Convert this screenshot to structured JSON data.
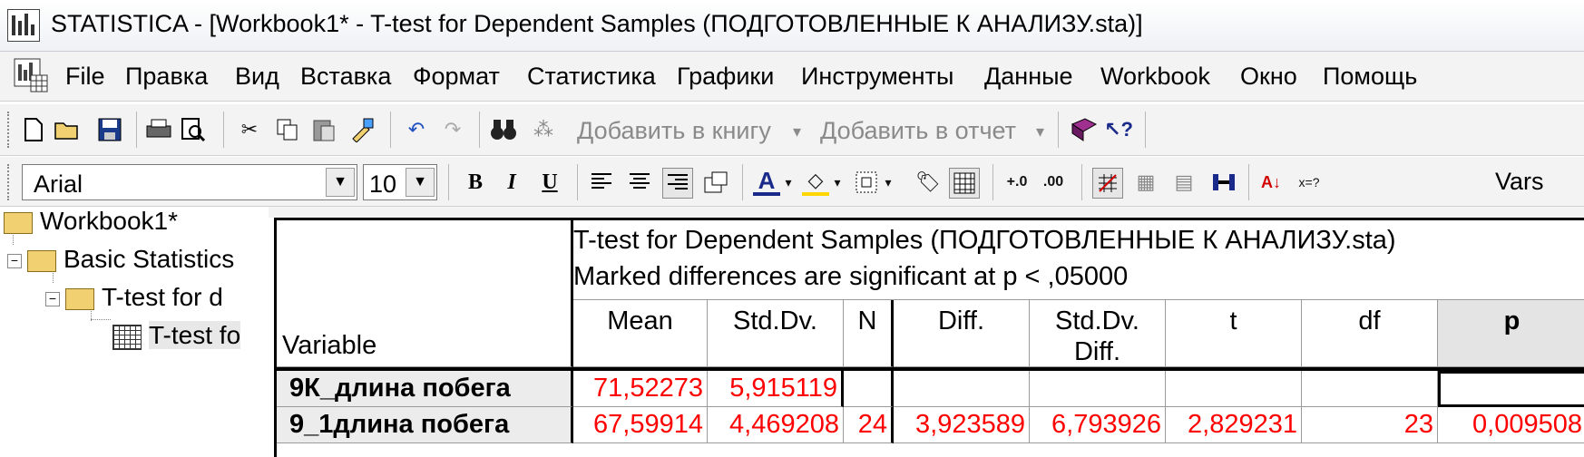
{
  "window": {
    "title": "STATISTICA - [Workbook1* - T-test for Dependent Samples (ПОДГОТОВЛЕННЫЕ К АНАЛИЗУ.sta)]"
  },
  "menu": {
    "items": [
      "File",
      "Правка",
      "Вид",
      "Вставка",
      "Формат",
      "Статистика",
      "Графики",
      "Инструменты",
      "Данные",
      "Workbook",
      "Окно",
      "Помощь"
    ]
  },
  "toolbar1": {
    "add_to_book": "Добавить в книгу",
    "add_to_report": "Добавить в отчет"
  },
  "toolbar2": {
    "font": "Arial",
    "size": "10",
    "bold": "B",
    "italic": "I",
    "underline": "U",
    "vars": "Vars"
  },
  "tree": {
    "root": "Workbook1*",
    "level1": "Basic Statistics",
    "level2": "T-test for d",
    "level3": "T-test fo"
  },
  "sheet": {
    "title_line1": "T-test for Dependent Samples (ПОДГОТОВЛЕННЫЕ К АНАЛИЗУ.sta)",
    "title_line2": "Marked differences are significant at p < ,05000",
    "variable_header": "Variable",
    "columns": [
      "Mean",
      "Std.Dv.",
      "N",
      "Diff.",
      "Std.Dv. Diff.",
      "t",
      "df",
      "p"
    ],
    "column_lines": [
      [
        "Mean"
      ],
      [
        "Std.Dv."
      ],
      [
        "N"
      ],
      [
        "Diff."
      ],
      [
        "Std.Dv.",
        "Diff."
      ],
      [
        "t"
      ],
      [
        "df"
      ],
      [
        "p"
      ]
    ],
    "rows": [
      {
        "variable": "9К_длина побега",
        "values": [
          "71,52273",
          "5,915119",
          "",
          "",
          "",
          "",
          "",
          ""
        ]
      },
      {
        "variable": "9_1длина побега",
        "values": [
          "67,59914",
          "4,469208",
          "24",
          "3,923589",
          "6,793926",
          "2,829231",
          "23",
          "0,009508"
        ]
      }
    ],
    "value_color": "#ff0000"
  }
}
